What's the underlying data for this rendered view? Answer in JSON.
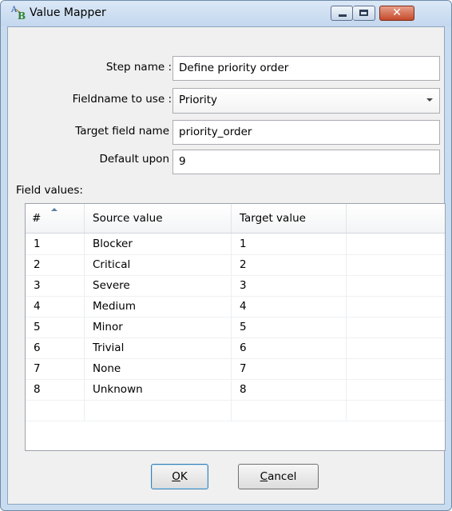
{
  "window": {
    "title": "Value Mapper",
    "close_glyph": "✕"
  },
  "form": {
    "step_name_label": "Step name :",
    "step_name_value": "Define priority order",
    "fieldname_label": "Fieldname to use :",
    "fieldname_value": "Priority",
    "target_field_label": "Target field name",
    "target_field_value": "priority_order",
    "default_label": "Default upon",
    "default_value": "9"
  },
  "field_values": {
    "label": "Field values:",
    "columns": [
      "#",
      "Source value",
      "Target value"
    ],
    "rows": [
      {
        "num": "1",
        "source": "Blocker",
        "target": "1"
      },
      {
        "num": "2",
        "source": "Critical",
        "target": "2"
      },
      {
        "num": "3",
        "source": "Severe",
        "target": "3"
      },
      {
        "num": "4",
        "source": "Medium",
        "target": "4"
      },
      {
        "num": "5",
        "source": "Minor",
        "target": "5"
      },
      {
        "num": "6",
        "source": "Trivial",
        "target": "6"
      },
      {
        "num": "7",
        "source": "None",
        "target": "7"
      },
      {
        "num": "8",
        "source": "Unknown",
        "target": "8"
      }
    ]
  },
  "buttons": {
    "ok_mnemonic": "O",
    "ok_rest": "K",
    "cancel_mnemonic": "C",
    "cancel_rest": "ancel"
  },
  "colors": {
    "titlebar": "#c3d7ee",
    "client_bg": "#f0f0f0",
    "close_button": "#c44a2b"
  }
}
